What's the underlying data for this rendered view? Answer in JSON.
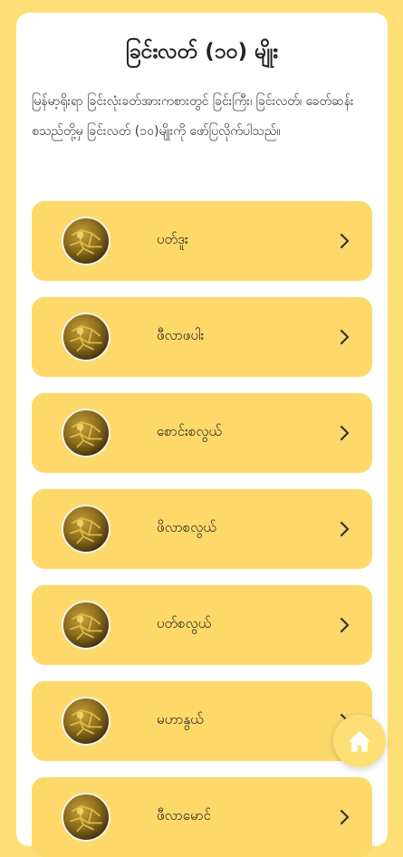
{
  "page": {
    "title": "ခြင်းလတ် (၁၀) မျိုး",
    "intro": "မြန်မာ့ရိုးရာ ခြင်းလုံးခတ်အားကစားတွင် ခြင်းကြီး၊ ခြင်းလတ်၊ ခေတ်ဆန်း စသည်တို့မှ ခြင်းလတ် (၁၀)မျိုးကို ဖော်ပြလိုက်ပါသည်။"
  },
  "items": [
    {
      "label": "ပတ်ဒူး"
    },
    {
      "label": "ဖီလာဖပါး"
    },
    {
      "label": "စောင်းစလွယ်"
    },
    {
      "label": "ဖိလာစလွယ်"
    },
    {
      "label": "ပတ်စလွယ်"
    },
    {
      "label": "မဟာနွယ်"
    },
    {
      "label": "ဖီလာမောင်"
    }
  ],
  "icons": {
    "item_icon": "chinlone-ball-icon",
    "chevron": "chevron-right-icon",
    "fab": "home-icon"
  },
  "colors": {
    "background": "#fddf75",
    "item_background": "#fdd96a",
    "card": "#ffffff",
    "home_icon": "#ffffff"
  }
}
